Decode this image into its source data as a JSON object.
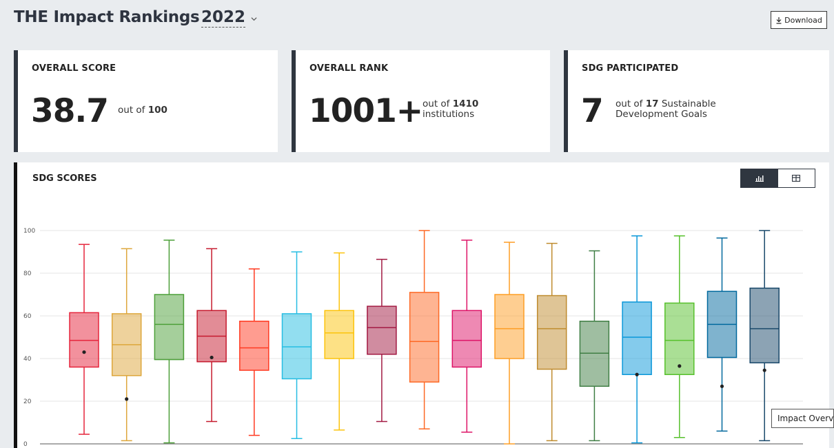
{
  "header": {
    "title": "THE Impact Rankings",
    "year": "2022",
    "download_label": "Download"
  },
  "cards": {
    "score": {
      "label": "OVERALL SCORE",
      "value": "38.7",
      "prefix": "out of",
      "total": "100"
    },
    "rank": {
      "label": "OVERALL RANK",
      "value": "1001+",
      "prefix": "out of",
      "total": "1410",
      "suffix": "institutions"
    },
    "sdg": {
      "label": "SDG PARTICIPATED",
      "value": "7",
      "prefix": "out of",
      "total": "17",
      "suffix1": "Sustainable",
      "suffix2": "Development Goals"
    }
  },
  "panel": {
    "title": "SDG SCORES",
    "tooltip": "Impact Overview"
  },
  "icons": {
    "chart_toggle": "bar-chart-icon",
    "table_toggle": "table-icon",
    "download": "download-icon",
    "year_dropdown": "chevron-down-icon"
  },
  "chart_data": {
    "type": "boxplot",
    "ylim": [
      0,
      100
    ],
    "yticks": [
      0,
      20,
      40,
      60,
      80,
      100
    ],
    "grid": true,
    "series": [
      {
        "color": "#e5243b",
        "min": 4.5,
        "q1": 36,
        "median": 48.5,
        "q3": 61.5,
        "max": 93.5,
        "point": 43
      },
      {
        "color": "#dda63a",
        "min": 1.5,
        "q1": 32,
        "median": 46.5,
        "q3": 61,
        "max": 91.5,
        "point": 21
      },
      {
        "color": "#4c9f38",
        "min": 0.5,
        "q1": 39.5,
        "median": 56,
        "q3": 70,
        "max": 95.5,
        "point": null
      },
      {
        "color": "#c5192d",
        "min": 10.5,
        "q1": 38.5,
        "median": 50.5,
        "q3": 62.5,
        "max": 91.5,
        "point": 40.5
      },
      {
        "color": "#ff3a21",
        "min": 4,
        "q1": 34.5,
        "median": 45,
        "q3": 57.5,
        "max": 82,
        "point": null
      },
      {
        "color": "#26bde2",
        "min": 2.5,
        "q1": 30.5,
        "median": 45.5,
        "q3": 61,
        "max": 90,
        "point": null
      },
      {
        "color": "#fcc30b",
        "min": 6.5,
        "q1": 40,
        "median": 52,
        "q3": 62.5,
        "max": 89.5,
        "point": null
      },
      {
        "color": "#a21942",
        "min": 10.5,
        "q1": 42,
        "median": 54.5,
        "q3": 64.5,
        "max": 86.5,
        "point": null
      },
      {
        "color": "#fd6925",
        "min": 7,
        "q1": 29,
        "median": 48,
        "q3": 71,
        "max": 100,
        "point": null
      },
      {
        "color": "#dd1367",
        "min": 5.5,
        "q1": 36,
        "median": 48.5,
        "q3": 62.5,
        "max": 95.5,
        "point": null
      },
      {
        "color": "#fd9d24",
        "min": 0,
        "q1": 40,
        "median": 54,
        "q3": 70,
        "max": 94.5,
        "point": null
      },
      {
        "color": "#bf8b2e",
        "min": 1.5,
        "q1": 35,
        "median": 54,
        "q3": 69.5,
        "max": 94,
        "point": null
      },
      {
        "color": "#3f7e44",
        "min": 1.5,
        "q1": 27,
        "median": 42.5,
        "q3": 57.5,
        "max": 90.5,
        "point": null
      },
      {
        "color": "#0a97d9",
        "min": 0.5,
        "q1": 32.5,
        "median": 50,
        "q3": 66.5,
        "max": 97.5,
        "point": 32.5
      },
      {
        "color": "#56c02b",
        "min": 3,
        "q1": 32.5,
        "median": 48.5,
        "q3": 66,
        "max": 97.5,
        "point": 36.5
      },
      {
        "color": "#00689d",
        "min": 6,
        "q1": 40.5,
        "median": 56,
        "q3": 71.5,
        "max": 96.5,
        "point": 27
      },
      {
        "color": "#19486a",
        "min": 1.5,
        "q1": 38,
        "median": 54,
        "q3": 73,
        "max": 100,
        "point": 34.5
      }
    ]
  }
}
